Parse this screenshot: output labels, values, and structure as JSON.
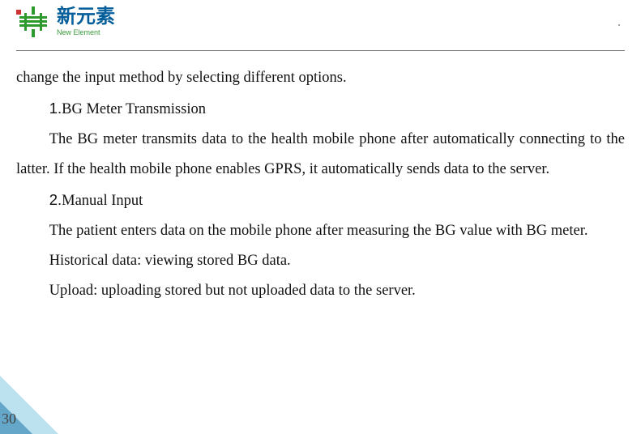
{
  "brand": {
    "cn": "新元素",
    "en": "New Element"
  },
  "body": {
    "p1": "change the input method by selecting different options.",
    "item1_num": "1.",
    "item1_title": "BG Meter Transmission",
    "item1_text": "The BG meter transmits data to the health mobile phone after automatically connecting to the latter. If the health mobile phone enables GPRS, it automatically sends data to the server.",
    "item2_num": "2.",
    "item2_title": "Manual Input",
    "item2_text": "The patient enters data on the mobile phone after measuring the BG value with BG meter.",
    "hist": "Historical data: viewing stored BG data.",
    "upload": "Upload: uploading stored but not uploaded data to the server."
  },
  "page_number": "30"
}
